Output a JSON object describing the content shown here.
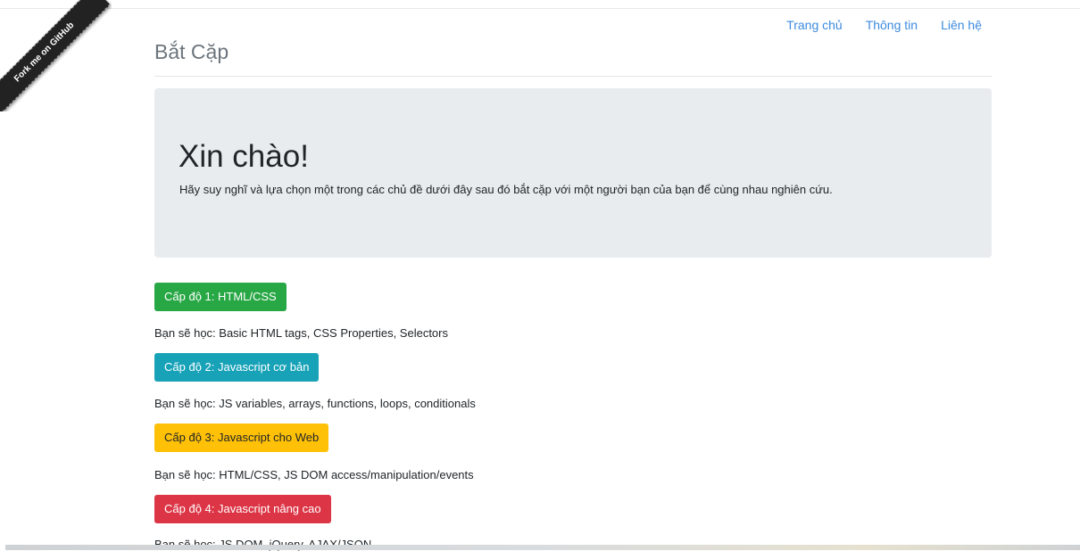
{
  "ribbon": {
    "label": "Fork me on GitHub"
  },
  "nav": {
    "items": [
      {
        "label": "Trang chủ"
      },
      {
        "label": "Thông tin"
      },
      {
        "label": "Liên hệ"
      }
    ]
  },
  "header": {
    "brand": "Bắt Cặp"
  },
  "hero": {
    "title": "Xin chào!",
    "lead": "Hãy suy nghĩ và lựa chọn một trong các chủ đề dưới đây sau đó bắt cặp với một người bạn của bạn để cùng nhau nghiên cứu."
  },
  "levels": [
    {
      "button": "Cấp độ 1: HTML/CSS",
      "learn": "Bạn sẽ học: Basic HTML tags, CSS Properties, Selectors",
      "color": "#28a745"
    },
    {
      "button": "Cấp độ 2: Javascript cơ bản",
      "learn": "Bạn sẽ học: JS variables, arrays, functions, loops, conditionals",
      "color": "#17a2b8"
    },
    {
      "button": "Cấp độ 3: Javascript cho Web",
      "learn": "Bạn sẽ học: HTML/CSS, JS DOM access/manipulation/events",
      "color": "#ffc107"
    },
    {
      "button": "Cấp độ 4: Javascript nâng cao",
      "learn": "Bạn sẽ học: JS DOM, jQuery, AJAX/JSON",
      "color": "#dc3545"
    }
  ]
}
